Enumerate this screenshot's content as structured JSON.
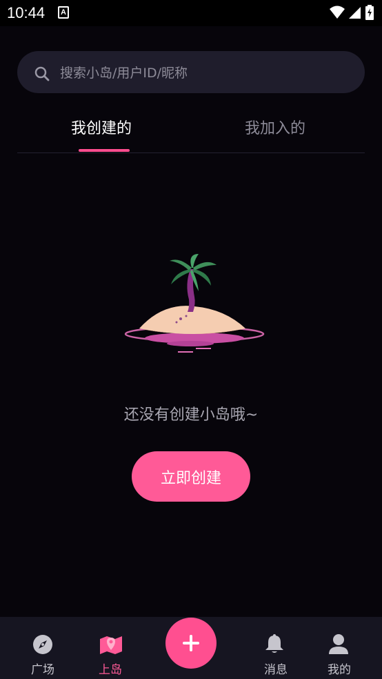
{
  "status_bar": {
    "time": "10:44",
    "left_icon": "a-notification-icon",
    "right_icons": [
      "wifi-icon",
      "signal-icon",
      "battery-icon"
    ]
  },
  "search": {
    "placeholder": "搜索小岛/用户ID/昵称"
  },
  "tabs": [
    {
      "label": "我创建的",
      "active": true
    },
    {
      "label": "我加入的",
      "active": false
    }
  ],
  "empty_state": {
    "illustration": "palm-island-illustration",
    "message": "还没有创建小岛哦~",
    "button_label": "立即创建"
  },
  "bottom_nav": {
    "items": [
      {
        "label": "广场",
        "icon": "compass-icon",
        "active": false
      },
      {
        "label": "上岛",
        "icon": "map-pin-icon",
        "active": true
      },
      {
        "label": "",
        "icon": "plus-icon",
        "active": false
      },
      {
        "label": "消息",
        "icon": "bell-icon",
        "active": false
      },
      {
        "label": "我的",
        "icon": "user-icon",
        "active": false
      }
    ]
  },
  "colors": {
    "accent": "#ff5a97",
    "background": "#07050b",
    "nav_background": "#161521",
    "search_background": "#1f1d2c"
  }
}
